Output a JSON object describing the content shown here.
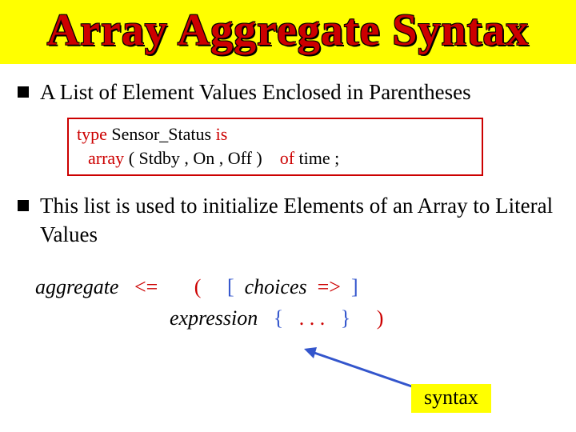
{
  "title": "Array Aggregate Syntax",
  "bullets": [
    {
      "text": "A List of Element Values Enclosed in Parentheses"
    },
    {
      "text": "This list is used to initialize Elements of an Array to Literal Values"
    }
  ],
  "code": {
    "kw_type": "type",
    "type_name": " Sensor_Status ",
    "kw_is": "is",
    "kw_array": "array",
    "enum_part": " ( Stdby , On , Off ) ",
    "kw_of": "of",
    "of_part": " time ;"
  },
  "grammar": {
    "lhs": "aggregate",
    "produces": "<=",
    "lparen": "(",
    "lbrack": "[",
    "choices": "choices",
    "arrow": "=>",
    "rbrack": "]",
    "expression": "expression",
    "lbrace": "{",
    "dots": ".  .  .",
    "rbrace": "}",
    "rparen": ")"
  },
  "syntax_label": "syntax"
}
